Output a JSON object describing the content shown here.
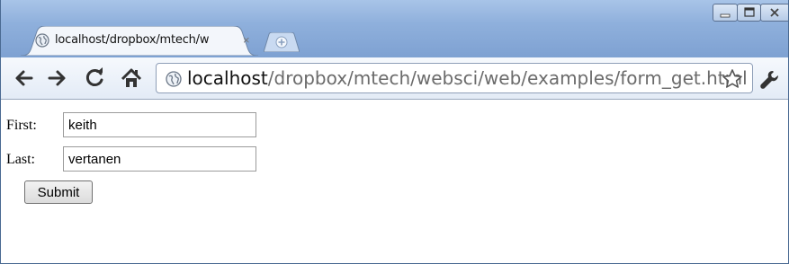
{
  "browser": {
    "tab": {
      "title": "localhost/dropbox/mtech/w",
      "close_glyph": "×"
    },
    "address": {
      "host": "localhost",
      "path": "/dropbox/mtech/websci/web/examples/form_get.html"
    }
  },
  "form": {
    "first_label": "First:",
    "first_value": "keith",
    "last_label": "Last:",
    "last_value": "vertanen",
    "submit_label": "Submit"
  },
  "colors": {
    "frame": "#7ea1d2",
    "toolbar": "#e3ebf6",
    "url_path": "#6b6b6b"
  },
  "icons": [
    "globe-icon",
    "close-icon",
    "new-tab-icon",
    "minimize-icon",
    "maximize-icon",
    "window-close-icon",
    "back-icon",
    "forward-icon",
    "reload-icon",
    "home-icon",
    "bookmark-star-icon",
    "wrench-icon"
  ]
}
